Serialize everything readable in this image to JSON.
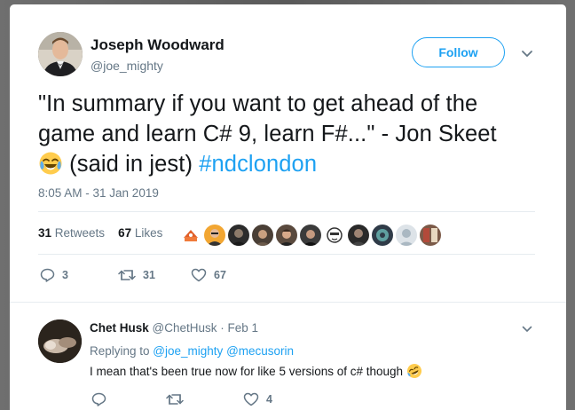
{
  "tweet": {
    "author": {
      "name": "Joseph Woodward",
      "handle": "@joe_mighty"
    },
    "follow_label": "Follow",
    "text_line1": "\"In summary if you want to get ahead of the",
    "text_line2": "game and learn C# 9, learn F#...\" - Jon Skeet",
    "text_line3_after_emoji": " (said in jest) ",
    "hashtag": "#ndclondon",
    "timestamp": "8:05 AM - 31 Jan 2019",
    "stats": {
      "retweets_count": "31",
      "retweets_label": " Retweets",
      "likes_count": "67",
      "likes_label": " Likes"
    },
    "actions": {
      "replies": "3",
      "retweets": "31",
      "likes": "67"
    }
  },
  "reply": {
    "author": {
      "name": "Chet Husk",
      "handle": "@ChetHusk",
      "date": " · Feb 1"
    },
    "replying_label": "Replying to ",
    "replying_to": [
      "@joe_mighty",
      "@mecusorin"
    ],
    "text": "I mean that's been true now for like 5 versions of c# though",
    "actions": {
      "replies": "",
      "retweets": "",
      "likes": "4"
    }
  },
  "colors": {
    "accent": "#1da1f2",
    "text": "#14171a",
    "muted": "#657786",
    "divider": "#e6ecf0"
  },
  "icons": [
    "chevron-down-icon",
    "reply-icon",
    "retweet-icon",
    "heart-icon",
    "tears-of-joy-emoji",
    "rofl-emoji"
  ]
}
